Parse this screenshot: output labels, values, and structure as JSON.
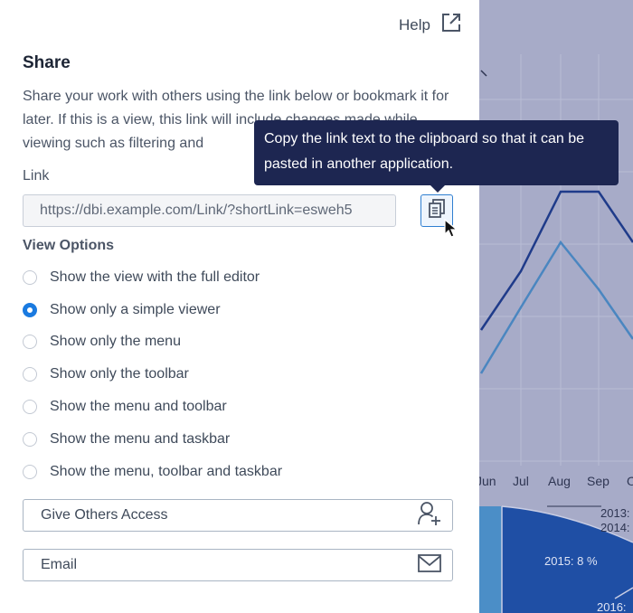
{
  "header": {
    "help_label": "Help"
  },
  "share": {
    "title": "Share",
    "description": "Share your work with others using the link below or bookmark it for later. If this is a view, this link will include changes made while viewing such as filtering and"
  },
  "link": {
    "label": "Link",
    "value": "https://dbi.example.com/Link/?shortLink=esweh5"
  },
  "tooltip": {
    "text": "Copy the link text to the clipboard so that it can be pasted in another application."
  },
  "view_options": {
    "title": "View Options",
    "options": [
      {
        "label": "Show the view with the full editor",
        "checked": false
      },
      {
        "label": "Show only a simple viewer",
        "checked": true
      },
      {
        "label": "Show only the menu",
        "checked": false
      },
      {
        "label": "Show only the toolbar",
        "checked": false
      },
      {
        "label": "Show the menu and toolbar",
        "checked": false
      },
      {
        "label": "Show the menu and taskbar",
        "checked": false
      },
      {
        "label": "Show the menu, toolbar and taskbar",
        "checked": false
      }
    ]
  },
  "actions": {
    "give_access_label": "Give Others Access",
    "email_label": "Email"
  },
  "background": {
    "months": [
      "Jun",
      "Jul",
      "Aug",
      "Sep",
      "O"
    ],
    "pie_labels": [
      "2013:",
      "2014:",
      "2015: 8 %",
      "2016:"
    ]
  },
  "colors": {
    "accent": "#1a7ae0",
    "tooltip_bg": "#1d2651",
    "backdrop": "#a7abc8"
  },
  "icons": [
    "external-link-icon",
    "copy-icon",
    "mouse-cursor-icon",
    "add-user-icon",
    "mail-icon"
  ]
}
